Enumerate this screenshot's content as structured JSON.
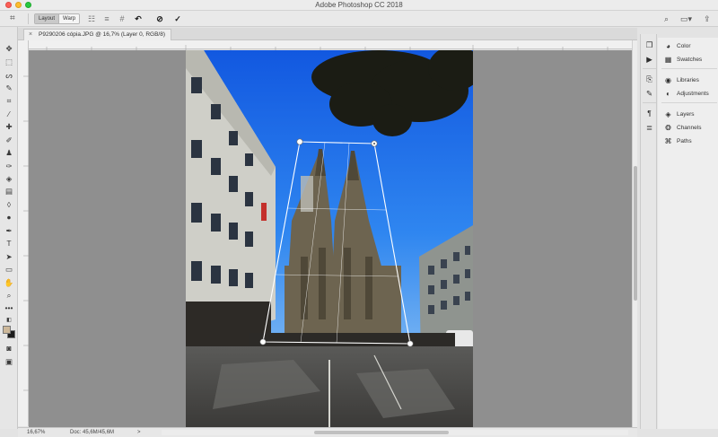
{
  "window": {
    "title": "Adobe Photoshop CC 2018"
  },
  "options_bar": {
    "tool_icon": "perspective-crop-icon",
    "mode_layout": "Layout",
    "mode_warp": "Warp",
    "icons": [
      "grid-icon",
      "lines-icon",
      "grid-hash-icon",
      "undo-warp-icon",
      "cancel-icon",
      "commit-check-icon"
    ],
    "right_icons": [
      "search-icon",
      "workspace-icon",
      "share-icon"
    ]
  },
  "document": {
    "tab_label": "P9290206 cópia.JPG @ 16,7% (Layer 0, RGB/8)",
    "close_glyph": "×"
  },
  "status": {
    "zoom": "16,67%",
    "doc_info": "Doc: 45,6M/45,6M",
    "arrow": ">"
  },
  "tools": [
    "move-icon",
    "marquee-icon",
    "lasso-icon",
    "quick-select-icon",
    "crop-icon",
    "eyedropper-icon",
    "healing-brush-icon",
    "brush-icon",
    "clone-stamp-icon",
    "history-brush-icon",
    "eraser-icon",
    "gradient-icon",
    "blur-icon",
    "dodge-icon",
    "pen-icon",
    "type-icon",
    "path-select-icon",
    "rectangle-icon",
    "hand-icon",
    "zoom-icon",
    "more-tools-icon"
  ],
  "panels": [
    {
      "label": "Color",
      "icon": "color-icon"
    },
    {
      "label": "Swatches",
      "icon": "swatches-icon"
    },
    {
      "label": "Libraries",
      "icon": "libraries-icon"
    },
    {
      "label": "Adjustments",
      "icon": "adjustments-icon"
    },
    {
      "label": "Layers",
      "icon": "layers-icon"
    },
    {
      "label": "Channels",
      "icon": "channels-icon"
    },
    {
      "label": "Paths",
      "icon": "paths-icon"
    }
  ],
  "colors": {
    "foreground": "#cdb89a",
    "background": "#1d1d1d",
    "canvas_bg": "#8f8f8f",
    "sky": "#1f6fe8"
  }
}
